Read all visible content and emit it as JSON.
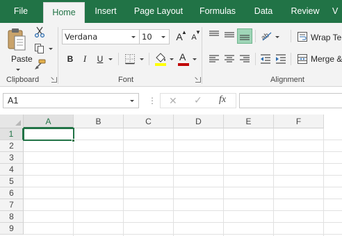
{
  "tabs": {
    "file": "File",
    "home": "Home",
    "insert": "Insert",
    "page_layout": "Page Layout",
    "formulas": "Formulas",
    "data": "Data",
    "review": "Review",
    "more": "V"
  },
  "ribbon": {
    "clipboard": {
      "group_label": "Clipboard",
      "paste_label": "Paste",
      "icons": [
        "paste-icon",
        "cut-icon",
        "copy-icon",
        "format-painter-icon"
      ]
    },
    "font": {
      "group_label": "Font",
      "font_name": "Verdana",
      "font_size": "10",
      "bold_label": "B",
      "italic_label": "I",
      "underline_label": "U",
      "grow_font": "A",
      "shrink_font": "A",
      "font_color_label": "A",
      "icons": [
        "borders-icon",
        "fill-color-icon",
        "font-color-icon"
      ]
    },
    "alignment": {
      "group_label": "Alignment",
      "wrap_text_label": "Wrap Te",
      "merge_label": "Merge &",
      "icons": [
        "align-top-icon",
        "align-middle-icon",
        "align-bottom-icon",
        "orientation-icon",
        "align-left-icon",
        "align-center-icon",
        "align-right-icon",
        "decrease-indent-icon",
        "increase-indent-icon"
      ]
    }
  },
  "formula_bar": {
    "name_box_value": "A1",
    "dots": "⋮",
    "cancel_icon": "✕",
    "enter_icon": "✓",
    "fx_label": "fx",
    "formula_value": ""
  },
  "grid": {
    "columns": [
      "A",
      "B",
      "C",
      "D",
      "E",
      "F"
    ],
    "rows": [
      "1",
      "2",
      "3",
      "4",
      "5",
      "6",
      "7",
      "8",
      "9"
    ],
    "active_cell": "A1"
  },
  "colors": {
    "brand_green": "#217346",
    "ribbon_bg": "#f3f3f3",
    "font_color_bar": "#c00000"
  }
}
